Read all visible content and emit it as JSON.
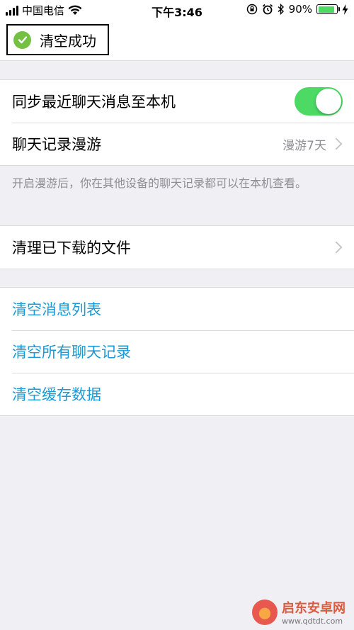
{
  "status_bar": {
    "carrier": "中国电信",
    "time": "下午3:46",
    "battery_percent": "90%",
    "battery_level": 0.9
  },
  "toast": {
    "text": "清空成功"
  },
  "settings": {
    "sync_recent": {
      "label": "同步最近聊天消息至本机",
      "enabled": true
    },
    "roaming": {
      "label": "聊天记录漫游",
      "value": "漫游7天"
    },
    "roaming_note": "开启漫游后，你在其他设备的聊天记录都可以在本机查看。",
    "clean_downloads": {
      "label": "清理已下载的文件"
    }
  },
  "actions": {
    "clear_message_list": "清空消息列表",
    "clear_all_records": "清空所有聊天记录",
    "clear_cache": "清空缓存数据"
  },
  "watermark": {
    "title": "启东安卓网",
    "url": "www.qdtdt.com"
  },
  "colors": {
    "toggle_on": "#4cd964",
    "link_blue": "#1a9ad6",
    "success_green": "#74c043"
  }
}
